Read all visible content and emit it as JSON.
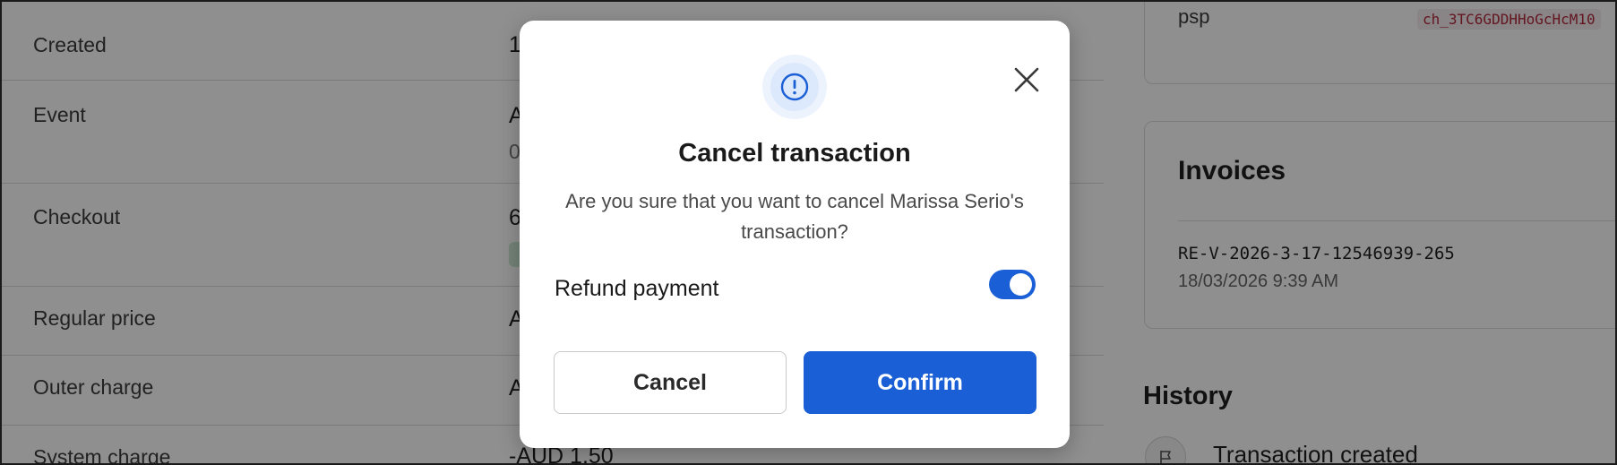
{
  "details": {
    "rows": [
      {
        "label": "Created",
        "value": "1"
      },
      {
        "label": "Event",
        "value": "A",
        "sub": "0"
      },
      {
        "label": "Checkout",
        "value": "6"
      },
      {
        "label": "Regular price",
        "value": "A"
      },
      {
        "label": "Outer charge",
        "value": "A"
      },
      {
        "label": "System charge",
        "value": "-AUD 1.50"
      }
    ]
  },
  "psp": {
    "label": "psp",
    "code": "ch_3TC6GDDHHoGcHcM10"
  },
  "invoices": {
    "title": "Invoices",
    "number": "RE-V-2026-3-17-12546939-265",
    "date": "18/03/2026 9:39 AM"
  },
  "history": {
    "title": "History",
    "first_entry": "Transaction created",
    "entry_icon": "flag-icon"
  },
  "modal": {
    "icon": "exclamation-circle-icon",
    "title": "Cancel transaction",
    "message": "Are you sure that you want to cancel Marissa Serio's transaction?",
    "refund_label": "Refund payment",
    "refund_enabled": true,
    "cancel_label": "Cancel",
    "confirm_label": "Confirm",
    "close_icon": "close-icon"
  },
  "colors": {
    "accent": "#1a5fd6",
    "overlay": "rgba(0,0,0,0.44)",
    "psp_code": "#b0283a"
  }
}
